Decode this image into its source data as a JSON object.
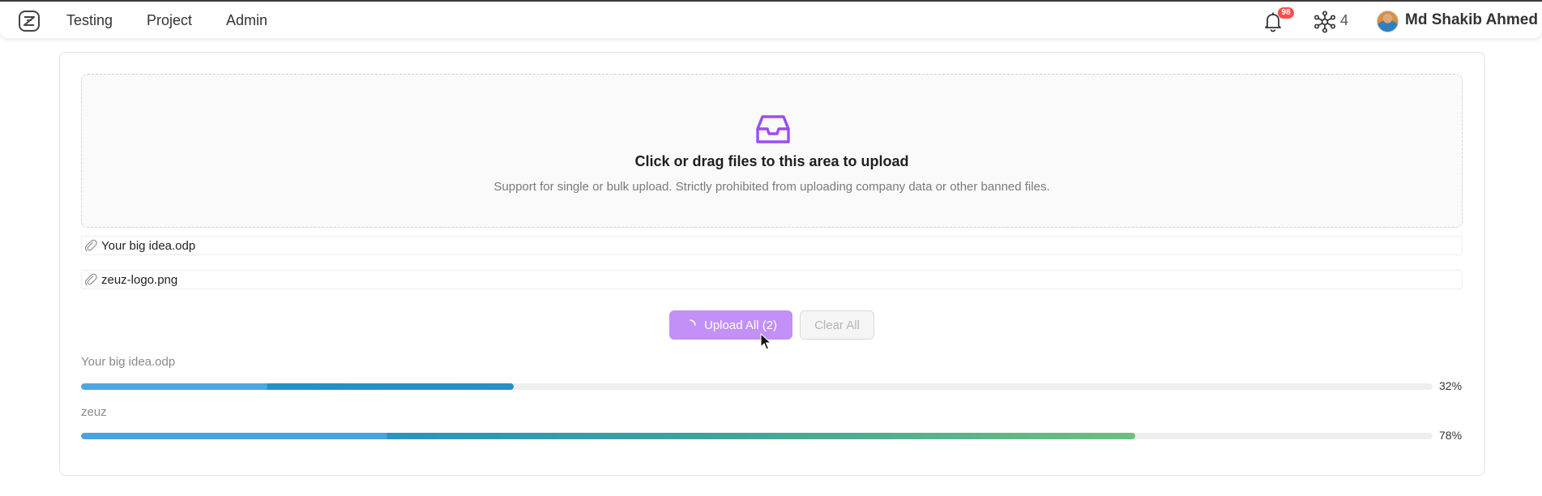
{
  "nav": {
    "links": [
      "Testing",
      "Project",
      "Admin"
    ],
    "notification_count": "98",
    "network_count": "4",
    "user_name": "Md Shakib Ahmed"
  },
  "dropzone": {
    "icon": "inbox-icon",
    "title": "Click or drag files to this area to upload",
    "hint": "Support for single or bulk upload. Strictly prohibited from uploading company data or other banned files."
  },
  "files": [
    {
      "name": "Your big idea.odp"
    },
    {
      "name": "zeuz-logo.png"
    }
  ],
  "actions": {
    "upload_label": "Upload All (2)",
    "clear_label": "Clear All"
  },
  "progress": [
    {
      "label": "Your big idea.odp",
      "percent": 32,
      "percent_text": "32%"
    },
    {
      "label": "zeuz",
      "percent": 78,
      "percent_text": "78%"
    }
  ],
  "colors": {
    "accent": "#9b4df0",
    "upload_button": "#c290f6",
    "badge": "#ff4d4f",
    "progress_start": "#4fa6e0",
    "progress_end": "#6cc07d"
  }
}
